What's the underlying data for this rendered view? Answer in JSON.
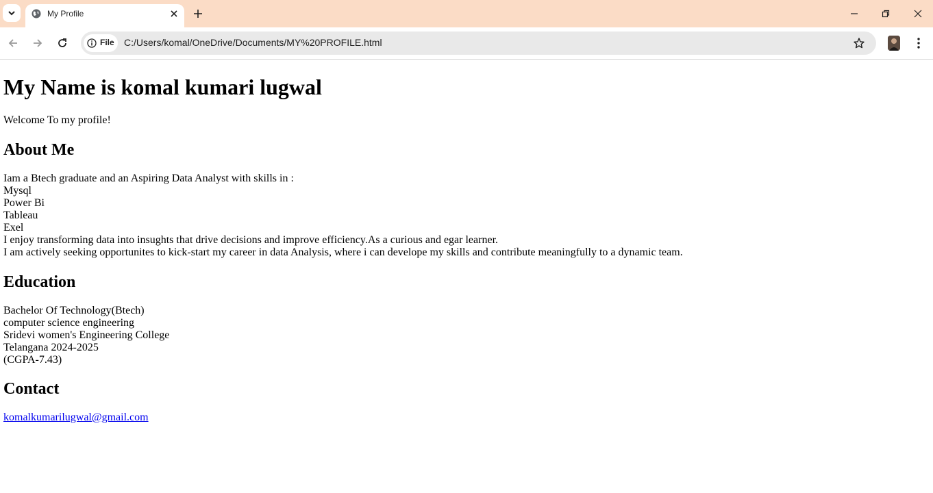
{
  "browser": {
    "tab_title": "My Profile",
    "address_chip": "File",
    "url": "C:/Users/komal/OneDrive/Documents/MY%20PROFILE.html"
  },
  "page": {
    "heading": "My Name is komal kumari lugwal",
    "welcome": "Welcome To my profile!",
    "about": {
      "heading": "About Me",
      "lines": [
        "Iam a Btech graduate and an Aspiring Data Analyst with skills in :",
        "Mysql",
        "Power Bi",
        "Tableau",
        "Exel",
        "I enjoy transforming data into insughts that drive decisions and improve efficiency.As a curious and egar learner.",
        "I am actively seeking opportunites to kick-start my career in data Analysis, where i can develope my skills and contribute meaningfully to a dynamic team."
      ]
    },
    "education": {
      "heading": "Education",
      "lines": [
        "Bachelor Of Technology(Btech)",
        "computer science engineering",
        "Sridevi women's Engineering College",
        "Telangana 2024-2025",
        "(CGPA-7.43)"
      ]
    },
    "contact": {
      "heading": "Contact",
      "email": "komalkumarilugwal@gmail.com"
    }
  }
}
